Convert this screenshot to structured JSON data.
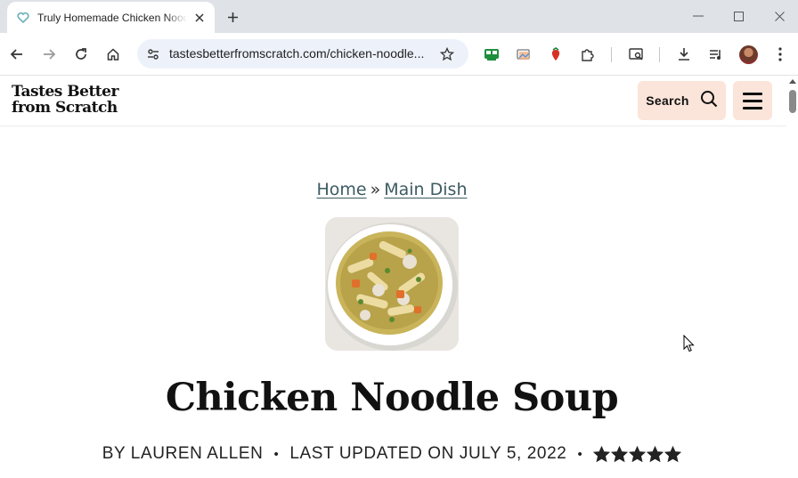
{
  "browser": {
    "tab_title": "Truly Homemade Chicken Noodle Soup",
    "url": "tastesbetterfromscratch.com/chicken-noodle..."
  },
  "site": {
    "logo_line1": "Tastes Better",
    "logo_line2": "from Scratch",
    "search_label": "Search"
  },
  "breadcrumb": {
    "home": "Home",
    "separator": "»",
    "category": "Main Dish"
  },
  "recipe": {
    "title": "Chicken Noodle Soup",
    "author": "BY LAUREN ALLEN",
    "dot": "•",
    "updated": "LAST UPDATED ON JULY 5, 2022",
    "rating": 5,
    "rating_max": 5
  },
  "colors": {
    "tab_strip": "#dfe3e8",
    "omnibox": "#edf2fa",
    "header_button": "#fbe4d9",
    "link": "#3d5b63"
  },
  "icons": {
    "tab_favicon": "heart-icon",
    "close": "close-icon",
    "new_tab": "plus-icon",
    "back": "back-arrow-icon",
    "forward": "forward-arrow-icon",
    "reload": "reload-icon",
    "home": "home-icon",
    "site_info": "tune-icon",
    "bookmark": "star-icon",
    "search": "magnifier-icon",
    "menu": "hamburger-icon"
  }
}
